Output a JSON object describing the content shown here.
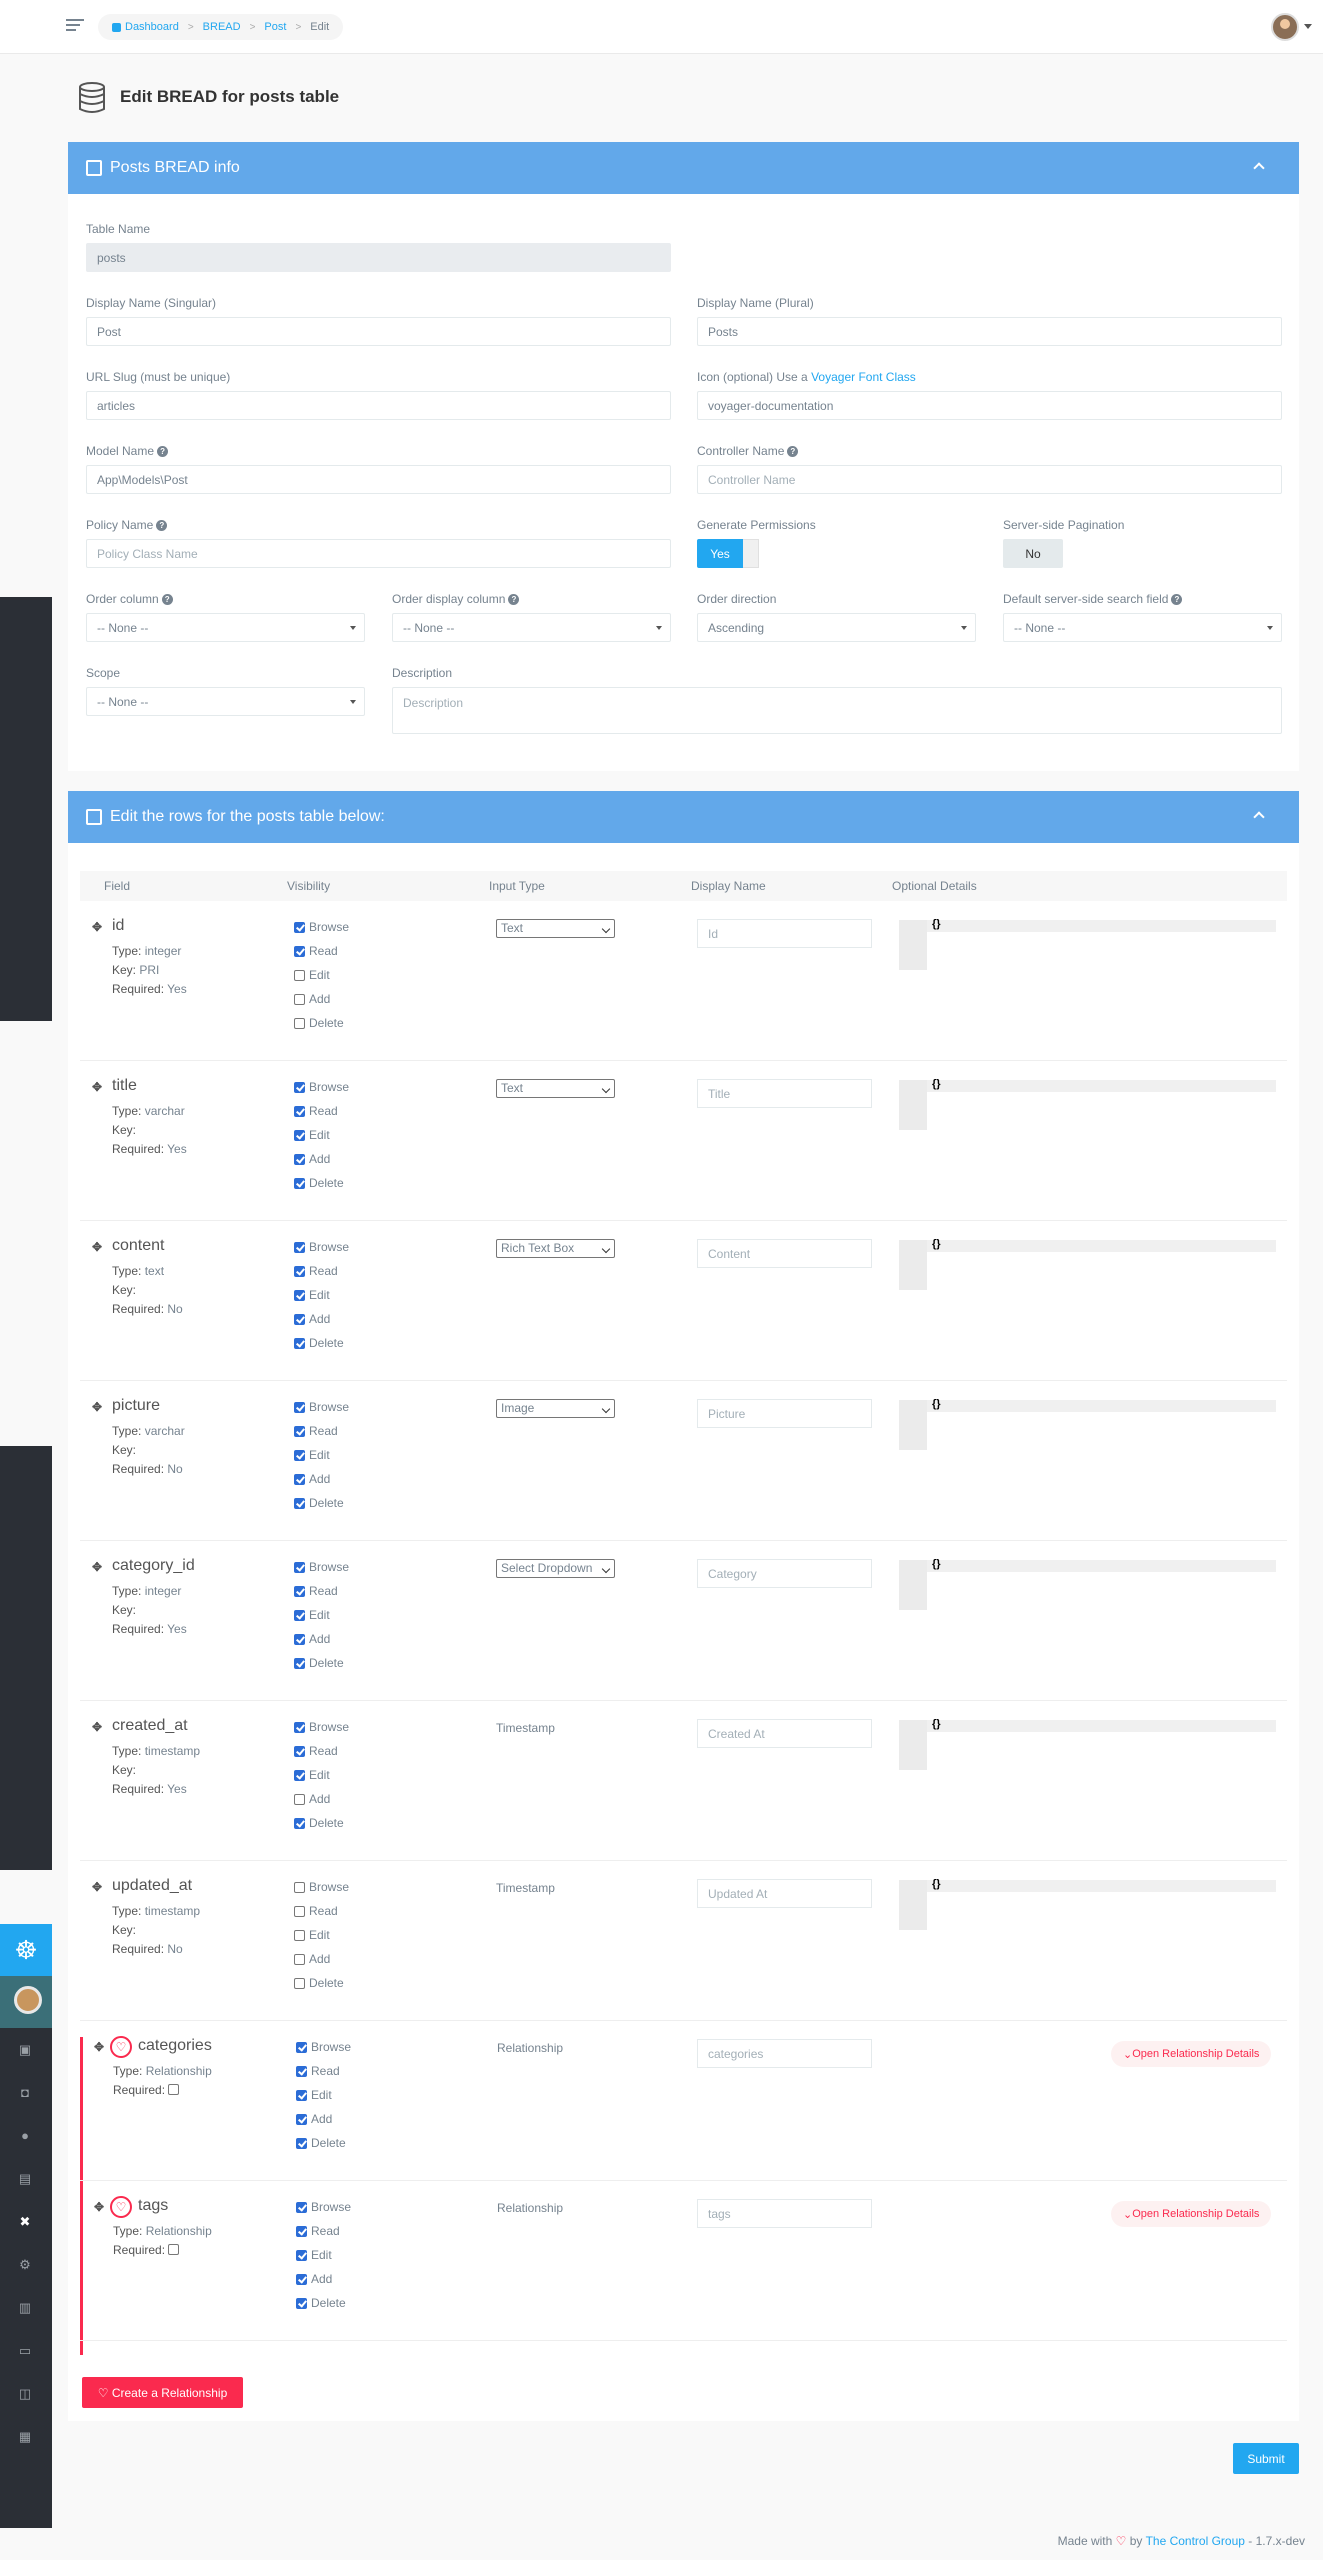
{
  "breadcrumb": [
    "Dashboard",
    "BREAD",
    "Post",
    "Edit"
  ],
  "page_title": "Edit BREAD for posts table",
  "info_panel": {
    "title": "Posts BREAD info",
    "table_name_label": "Table Name",
    "table_name_value": "posts",
    "display_singular_label": "Display Name (Singular)",
    "display_singular_value": "Post",
    "display_plural_label": "Display Name (Plural)",
    "display_plural_value": "Posts",
    "slug_label": "URL Slug (must be unique)",
    "slug_value": "articles",
    "icon_label_prefix": "Icon (optional) Use a",
    "icon_label_link": "Voyager Font Class",
    "icon_value": "voyager-documentation",
    "model_label": "Model Name",
    "model_value": "App\\Models\\Post",
    "controller_label": "Controller Name",
    "controller_placeholder": "Controller Name",
    "policy_label": "Policy Name",
    "policy_placeholder": "Policy Class Name",
    "gen_perm_label": "Generate Permissions",
    "gen_perm_value": "Yes",
    "pagination_label": "Server-side Pagination",
    "pagination_value": "No",
    "order_column_label": "Order column",
    "order_column_value": "-- None --",
    "order_display_label": "Order display column",
    "order_display_value": "-- None --",
    "order_direction_label": "Order direction",
    "order_direction_value": "Ascending",
    "default_search_label": "Default server-side search field",
    "default_search_value": "-- None --",
    "scope_label": "Scope",
    "scope_value": "-- None --",
    "description_label": "Description",
    "description_placeholder": "Description"
  },
  "rows_panel": {
    "title": "Edit the rows for the posts table below:",
    "headers": [
      "Field",
      "Visibility",
      "Input Type",
      "Display Name",
      "Optional Details"
    ],
    "meta_labels": {
      "type": "Type:",
      "key": "Key:",
      "required": "Required:"
    },
    "visibility_labels": [
      "Browse",
      "Read",
      "Edit",
      "Add",
      "Delete"
    ],
    "rows": [
      {
        "field": "id",
        "type": "integer",
        "key": "PRI",
        "required": "Yes",
        "vis": [
          true,
          true,
          false,
          false,
          false
        ],
        "input": "Text",
        "input_is_select": true,
        "display": "Id"
      },
      {
        "field": "title",
        "type": "varchar",
        "key": "",
        "required": "Yes",
        "vis": [
          true,
          true,
          true,
          true,
          true
        ],
        "input": "Text",
        "input_is_select": true,
        "display": "Title"
      },
      {
        "field": "content",
        "type": "text",
        "key": "",
        "required": "No",
        "vis": [
          true,
          true,
          true,
          true,
          true
        ],
        "input": "Rich Text Box",
        "input_is_select": true,
        "display": "Content"
      },
      {
        "field": "picture",
        "type": "varchar",
        "key": "",
        "required": "No",
        "vis": [
          true,
          true,
          true,
          true,
          true
        ],
        "input": "Image",
        "input_is_select": true,
        "display": "Picture"
      },
      {
        "field": "category_id",
        "type": "integer",
        "key": "",
        "required": "Yes",
        "vis": [
          true,
          true,
          true,
          true,
          true
        ],
        "input": "Select Dropdown",
        "input_is_select": true,
        "display": "Category"
      },
      {
        "field": "created_at",
        "type": "timestamp",
        "key": "",
        "required": "Yes",
        "vis": [
          true,
          true,
          true,
          false,
          true
        ],
        "input": "Timestamp",
        "input_is_select": false,
        "display": "Created At"
      },
      {
        "field": "updated_at",
        "type": "timestamp",
        "key": "",
        "required": "No",
        "vis": [
          false,
          false,
          false,
          false,
          false
        ],
        "input": "Timestamp",
        "input_is_select": false,
        "display": "Updated At"
      }
    ],
    "relationships": [
      {
        "field": "categories",
        "type": "Relationship",
        "vis": [
          true,
          true,
          true,
          true,
          true
        ],
        "input": "Relationship",
        "display": "categories",
        "details_btn": "Open Relationship Details"
      },
      {
        "field": "tags",
        "type": "Relationship",
        "vis": [
          true,
          true,
          true,
          true,
          true
        ],
        "input": "Relationship",
        "display": "tags",
        "details_btn": "Open Relationship Details"
      }
    ],
    "editor_glyph": "{}"
  },
  "create_relationship": "Create a Relationship",
  "submit": "Submit",
  "footer": {
    "made_with": "Made with",
    "by": "by",
    "company": "The Control Group",
    "version": "- 1.7.x-dev"
  },
  "colors": {
    "primary": "#22a7f0",
    "panel": "#62a8ea",
    "danger": "#fa2a4e"
  }
}
